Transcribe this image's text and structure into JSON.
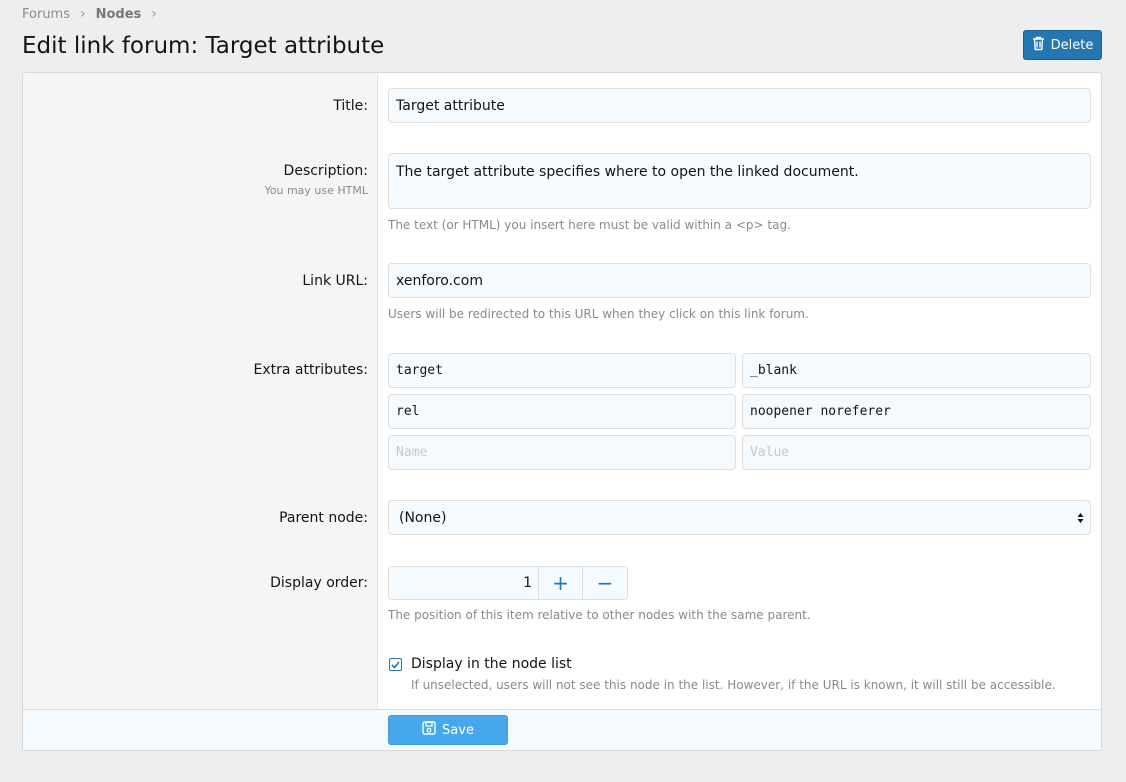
{
  "breadcrumb": {
    "items": [
      "Forums",
      "Nodes"
    ],
    "separator": "›"
  },
  "page": {
    "title": "Edit link forum: Target attribute"
  },
  "delete_button": {
    "label": "Delete",
    "icon": "trash-icon"
  },
  "form": {
    "title": {
      "label": "Title:",
      "value": "Target attribute"
    },
    "description": {
      "label": "Description:",
      "hint": "You may use HTML",
      "value": "The target attribute specifies where to open the linked document.",
      "explain": "The text (or HTML) you insert here must be valid within a <p> tag."
    },
    "link_url": {
      "label": "Link URL:",
      "value": "xenforo.com",
      "explain": "Users will be redirected to this URL when they click on this link forum."
    },
    "extra_attributes": {
      "label": "Extra attributes:",
      "rows": [
        {
          "name": "target",
          "value": "_blank"
        },
        {
          "name": "rel",
          "value": "noopener noreferer"
        }
      ],
      "name_placeholder": "Name",
      "value_placeholder": "Value"
    },
    "parent_node": {
      "label": "Parent node:",
      "selected": "(None)"
    },
    "display_order": {
      "label": "Display order:",
      "value": "1",
      "increment_label": "+",
      "decrement_label": "−",
      "explain": "The position of this item relative to other nodes with the same parent."
    },
    "display_in_list": {
      "label": "Display in the node list",
      "checked": true,
      "hint": "If unselected, users will not see this node in the list. However, if the URL is known, it will still be accessible."
    }
  },
  "save_button": {
    "label": "Save",
    "icon": "save-icon"
  },
  "colors": {
    "accent": "#2577b1",
    "save": "#47a7eb",
    "input_bg": "#f5fafe",
    "label_bg": "#f5f5f5"
  }
}
